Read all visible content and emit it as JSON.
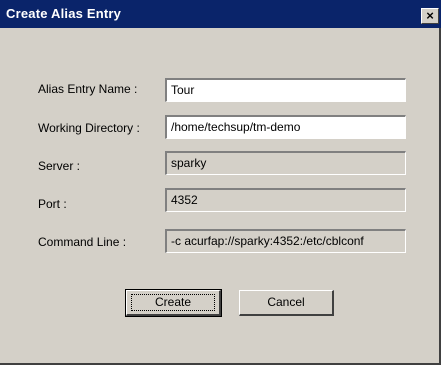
{
  "window": {
    "title": "Create Alias Entry",
    "close_glyph": "×",
    "close_icon": "close-icon"
  },
  "form": {
    "alias_entry_name": {
      "label": "Alias Entry Name :",
      "value": "Tour"
    },
    "working_directory": {
      "label": "Working Directory :",
      "value": "/home/techsup/tm-demo"
    },
    "server": {
      "label": "Server :",
      "value": "sparky"
    },
    "port": {
      "label": "Port :",
      "value": "4352"
    },
    "command_line": {
      "label": "Command Line :",
      "value": "-c acurfap://sparky:4352:/etc/cblconf"
    }
  },
  "buttons": {
    "create": "Create",
    "cancel": "Cancel"
  },
  "colors": {
    "titlebar": "#0a246a",
    "dialog_bg": "#d4d0c8",
    "field_bg": "#ffffff"
  }
}
